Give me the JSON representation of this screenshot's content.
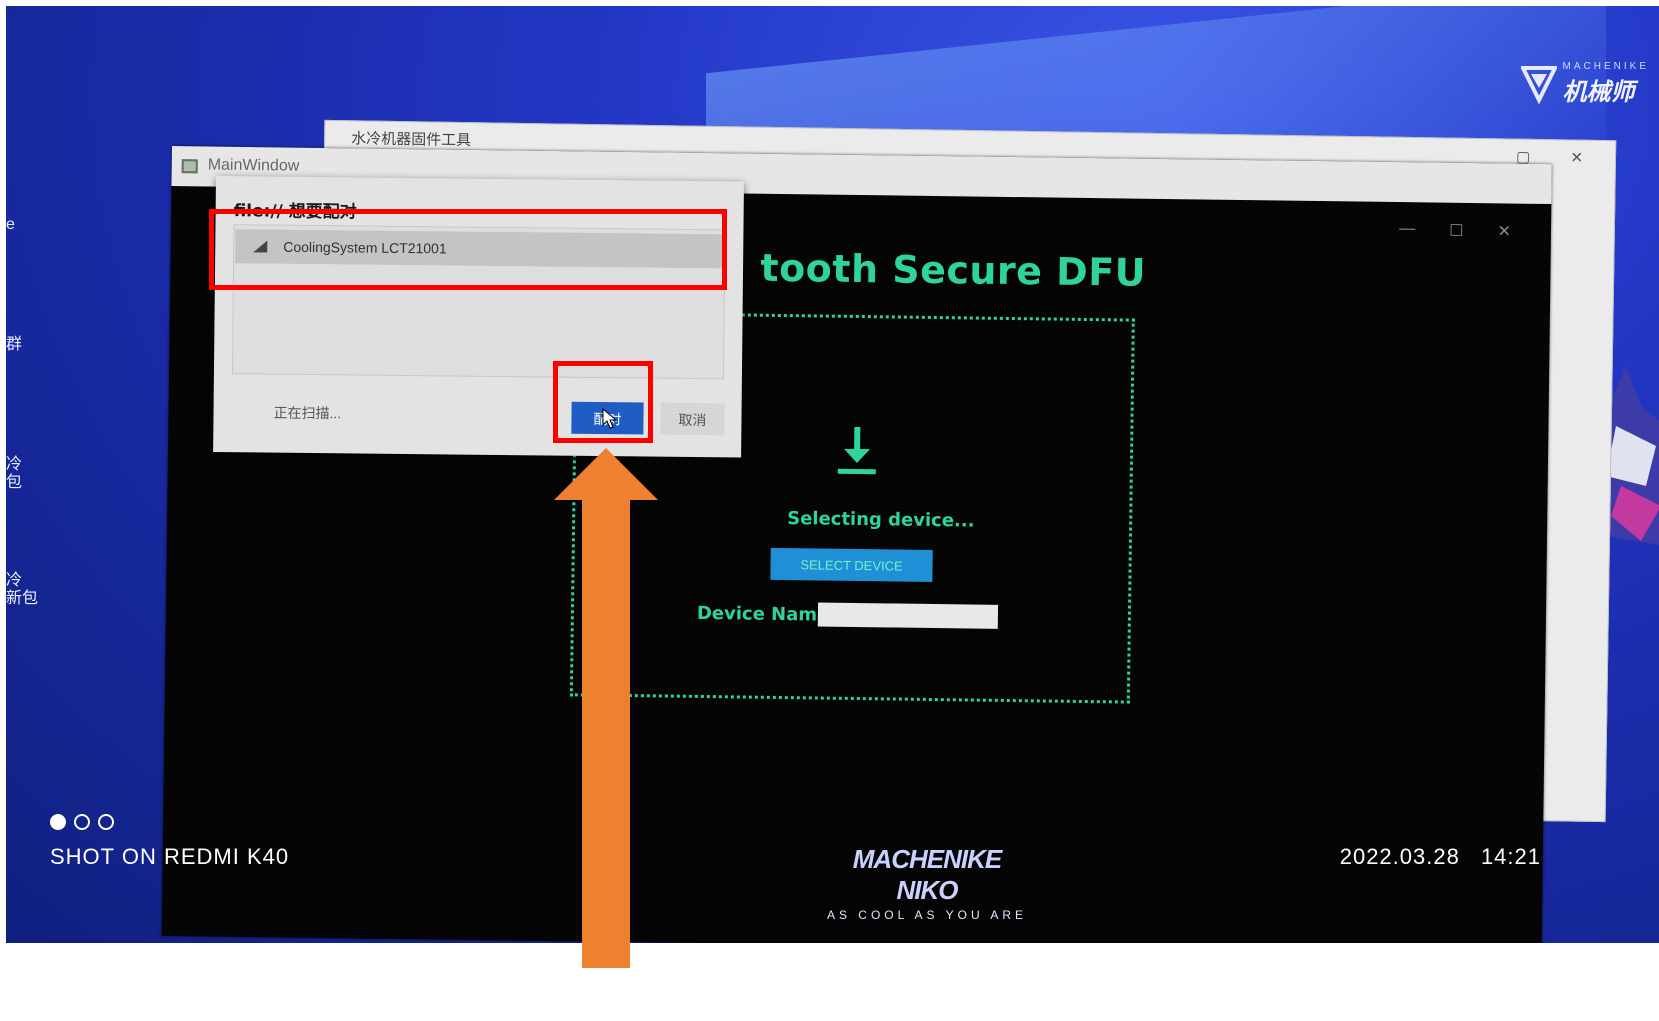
{
  "desktop": {
    "brand": {
      "sub": "MACHENIKE",
      "main": "机械师"
    },
    "side_labels": [
      "e",
      "群",
      "冷",
      "包",
      "冷",
      "新包"
    ]
  },
  "back_window": {
    "title": "水冷机器固件工具"
  },
  "main_window": {
    "title": "MainWindow",
    "heading": "tooth Secure DFU",
    "status": "Selecting device...",
    "select_button": "SELECT DEVICE",
    "device_name_label": "Device Name :",
    "device_name_value": ""
  },
  "pair_dialog": {
    "title": "file:// 想要配对",
    "devices": [
      {
        "name": "CoolingSystem LCT21001"
      }
    ],
    "scanning_text": "正在扫描...",
    "pair_button": "配对",
    "cancel_button": "取消"
  },
  "monitor_brand": {
    "main": "MACHENIKE NIKO",
    "slogan": "AS COOL AS YOU ARE"
  },
  "watermark": {
    "device": "SHOT ON REDMI K40",
    "datetime": "2022.03.28 14:21"
  },
  "colors": {
    "accent_green": "#2fd49a",
    "annotation_red": "#ff0000",
    "annotation_arrow": "#ee8130",
    "pair_blue": "#1f5cc4"
  }
}
